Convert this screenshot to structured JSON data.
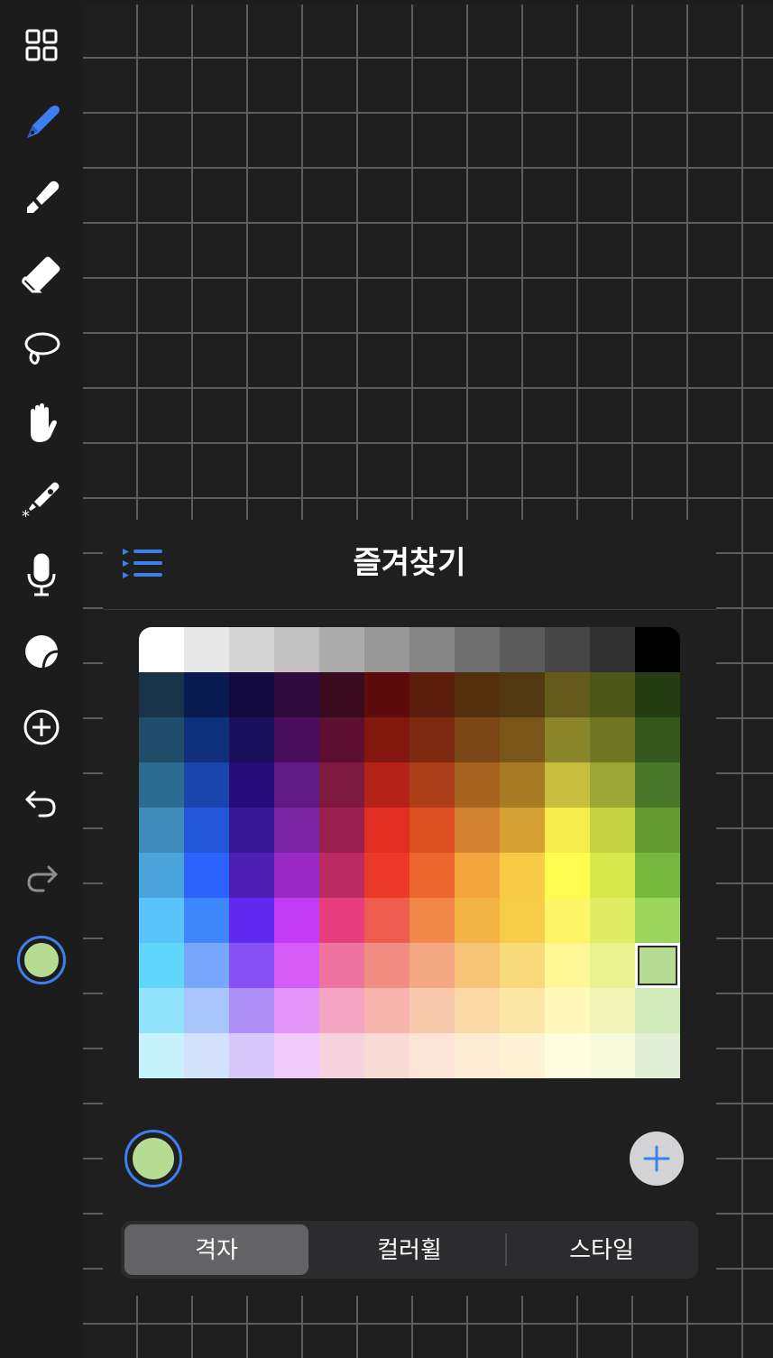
{
  "panel": {
    "title": "즐겨찾기",
    "selected_color": "#b6dc94",
    "tabs": [
      {
        "label": "격자",
        "active": true
      },
      {
        "label": "컬러휠",
        "active": false
      },
      {
        "label": "스타일",
        "active": false
      }
    ]
  },
  "toolbar": {
    "accent_color": "#3e7ff0",
    "icon_color": "#ffffff",
    "tools": [
      "grid-view-icon",
      "pen-icon",
      "highlighter-icon",
      "eraser-icon",
      "lasso-icon",
      "hand-icon",
      "laser-pointer-icon",
      "microphone-icon",
      "sticker-icon",
      "add-circle-icon",
      "undo-icon",
      "redo-icon"
    ]
  },
  "swatches": [
    [
      "#ffffff",
      "#e8e8e8",
      "#d4d4d4",
      "#c1c1c1",
      "#acacac",
      "#999999",
      "#858585",
      "#707070",
      "#5b5b5b",
      "#464646",
      "#323232",
      "#000000"
    ],
    [
      "#17344a",
      "#091c52",
      "#130b40",
      "#2f0a3e",
      "#3a0a1e",
      "#5c0c0b",
      "#5b1c0c",
      "#54300f",
      "#513811",
      "#62591b",
      "#4b5618",
      "#253d12"
    ],
    [
      "#204e6a",
      "#102f7a",
      "#1a0f5a",
      "#480d5d",
      "#5c0f2e",
      "#84170f",
      "#7e2a11",
      "#7b4716",
      "#7a561a",
      "#8a8528",
      "#6f7523",
      "#34571b"
    ],
    [
      "#2c6c92",
      "#1a45ac",
      "#260b7b",
      "#611a86",
      "#7e1a40",
      "#b52318",
      "#ab3d19",
      "#a76420",
      "#a77c25",
      "#c6be3c",
      "#9ba635",
      "#49782a"
    ],
    [
      "#3e8ab8",
      "#2456da",
      "#381a98",
      "#7b24a4",
      "#9b2050",
      "#e02e22",
      "#dc5022",
      "#d38130",
      "#d6a134",
      "#f5ec4c",
      "#c5d241",
      "#649b31"
    ],
    [
      "#4aa3db",
      "#2b62fb",
      "#4c1fb5",
      "#9a29c6",
      "#bb2a60",
      "#ea3a27",
      "#ec6630",
      "#f2a53b",
      "#f7cb45",
      "#fefc4f",
      "#d5ea4a",
      "#75b83d"
    ],
    [
      "#5bc5fb",
      "#3d87fb",
      "#5f2af0",
      "#c33bf5",
      "#e63e7c",
      "#ec5d4f",
      "#f08748",
      "#f4b443",
      "#f6cd49",
      "#fef568",
      "#e1ed64",
      "#9bd55d"
    ],
    [
      "#61d8fb",
      "#77a7fb",
      "#8650f4",
      "#d75cf6",
      "#ee739f",
      "#f28d83",
      "#f4a883",
      "#f7c377",
      "#f8d97a",
      "#fff796",
      "#eaf290",
      "#b6dc94"
    ],
    [
      "#90e3fb",
      "#a8c6fc",
      "#ad8ef7",
      "#e596f9",
      "#f3a5c1",
      "#f6b4ad",
      "#f8c8ad",
      "#fad9a7",
      "#fce6a7",
      "#fffabc",
      "#f1f6b8",
      "#cfe9b8"
    ],
    [
      "#c6f1fd",
      "#d3e1fd",
      "#d6c8fb",
      "#f0cafc",
      "#f9d2e0",
      "#fadad5",
      "#fbe4d6",
      "#fcecd3",
      "#fdf3d3",
      "#fffdde",
      "#f8fbdc",
      "#e1efd8"
    ]
  ],
  "selected_swatch": {
    "row": 7,
    "col": 11
  }
}
